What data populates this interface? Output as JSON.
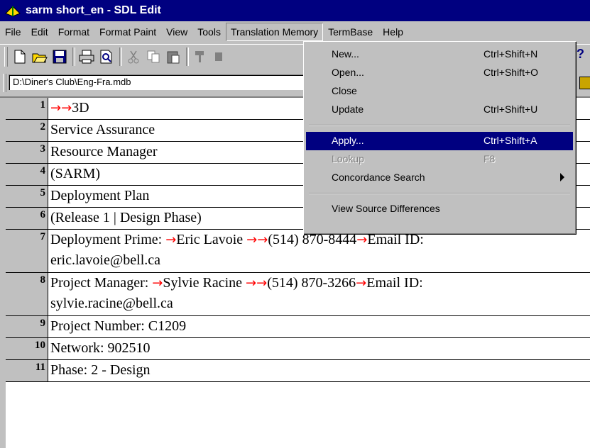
{
  "window": {
    "title": "sarm short_en - SDL Edit"
  },
  "menubar": {
    "items": [
      "File",
      "Edit",
      "Format",
      "Format Paint",
      "View",
      "Tools",
      "Translation Memory",
      "TermBase",
      "Help"
    ]
  },
  "toolbar": {
    "icons": [
      "new-icon",
      "open-folder-icon",
      "save-icon",
      "print-icon",
      "print-preview-icon",
      "cut-icon",
      "copy-icon",
      "paste-icon",
      "format-paint-icon"
    ],
    "help_glyph": "?"
  },
  "tm_bar": {
    "path": "D:\\Diner's Club\\Eng-Fra.mdb"
  },
  "tm_menu": {
    "items": [
      {
        "label": "New...",
        "shortcut": "Ctrl+Shift+N"
      },
      {
        "label": "Open...",
        "shortcut": "Ctrl+Shift+O"
      },
      {
        "label": "Close",
        "shortcut": ""
      },
      {
        "label": "Update",
        "shortcut": "Ctrl+Shift+U"
      },
      {
        "label": "Apply...",
        "shortcut": "Ctrl+Shift+A"
      },
      {
        "label": "Lookup",
        "shortcut": "F8"
      },
      {
        "label": "Concordance Search",
        "shortcut": ""
      },
      {
        "label": "View Source Differences",
        "shortcut": ""
      }
    ]
  },
  "segments": [
    {
      "num": "1",
      "text": "3D"
    },
    {
      "num": "2",
      "text": "Service Assurance"
    },
    {
      "num": "3",
      "text": "Resource Manager"
    },
    {
      "num": "4",
      "text": "(SARM)"
    },
    {
      "num": "5",
      "text": "Deployment Plan"
    },
    {
      "num": "6",
      "text": "(Release 1 | Design Phase)"
    },
    {
      "num": "7",
      "line1_a": "Deployment Prime: ",
      "line1_b": "Eric Lavoie ",
      "line1_c": "(514) 870-8444",
      "line1_d": "Email ID:",
      "line2": "eric.lavoie@bell.ca"
    },
    {
      "num": "8",
      "line1_a": "Project Manager: ",
      "line1_b": "Sylvie Racine ",
      "line1_c": "(514) 870-3266",
      "line1_d": "Email ID:",
      "line2": "sylvie.racine@bell.ca"
    },
    {
      "num": "9",
      "text": "Project Number: C1209"
    },
    {
      "num": "10",
      "text": "Network:  902510"
    },
    {
      "num": "11",
      "text": "Phase:  2 - Design"
    }
  ],
  "colors": {
    "title_bg": "#000080",
    "selection": "#000080",
    "tab_arrow": "#ff0000"
  }
}
